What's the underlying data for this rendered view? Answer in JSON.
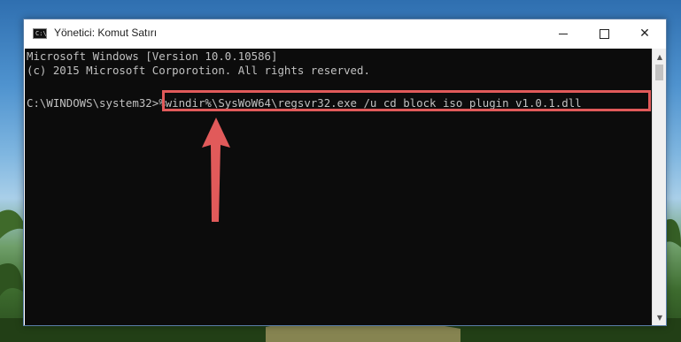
{
  "window": {
    "title": "Yönetici: Komut Satırı",
    "icon": "cmd-icon"
  },
  "controls": {
    "minimize_icon": "minimize-icon",
    "maximize_icon": "maximize-icon",
    "close_glyph": "✕"
  },
  "console": {
    "lines": [
      "Microsoft Windows [Version 10.0.10586]",
      "(c) 2015 Microsoft Corporotion. All rights reserved."
    ],
    "prompt": "C:\\WINDOWS\\system32>",
    "command": "%windir%\\SysWoW64\\regsvr32.exe /u cd_block_iso_plugin_v1.0.1.dll"
  },
  "annotation": {
    "highlight_color": "#e15a5a",
    "arrow_color": "#e15a5a"
  },
  "scrollbar": {
    "up_glyph": "▲",
    "down_glyph": "▼"
  }
}
